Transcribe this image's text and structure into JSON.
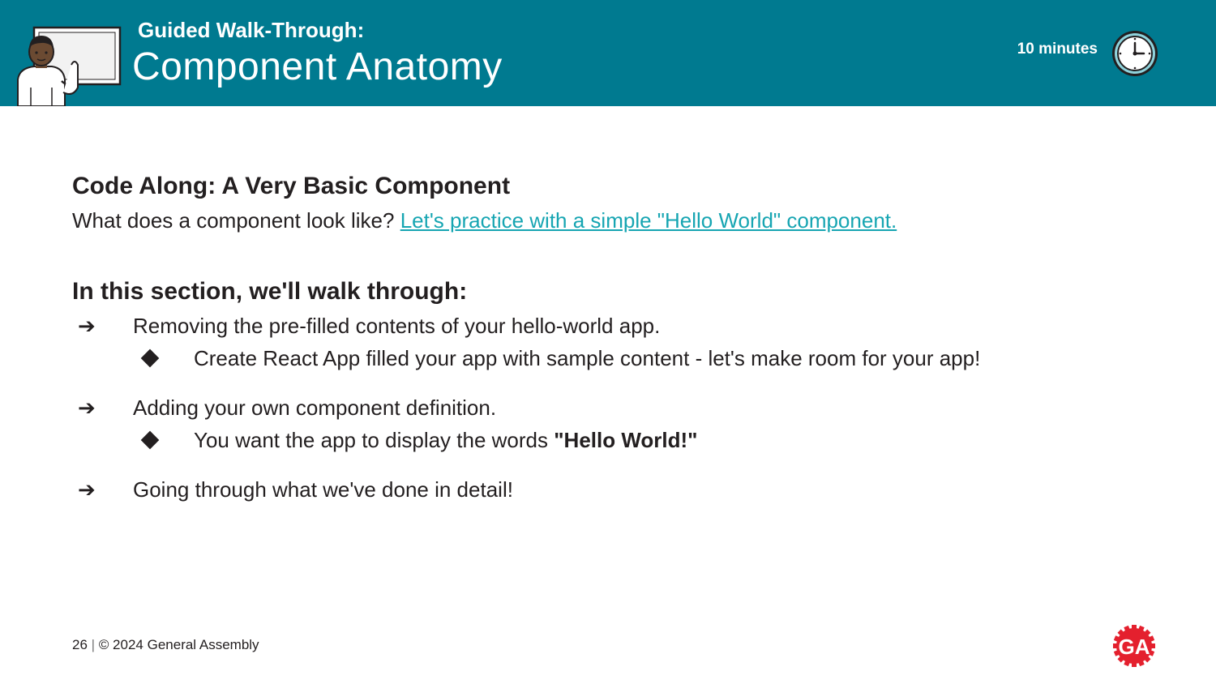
{
  "header": {
    "kicker": "Guided Walk-Through:",
    "title": "Component Anatomy",
    "duration": "10 minutes",
    "background_color": "#007a90"
  },
  "section1": {
    "heading": "Code Along: A Very Basic Component",
    "text": "What does a component look like?",
    "link_text": "Let's practice with a simple \"Hello World\" component."
  },
  "section2": {
    "heading": "In this section, we'll walk through:",
    "bullets": [
      {
        "text": "Removing the pre-filled contents of your hello-world app.",
        "sub": "Create React App filled your app with sample content - let's make room for your app!"
      },
      {
        "text": "Adding your own component definition.",
        "sub_prefix": "You want the app to display the words",
        "sub_bold": "\"Hello World!\""
      },
      {
        "text": "Going through what we've done in detail!"
      }
    ]
  },
  "footer": {
    "page": "26",
    "separator": "|",
    "copyright": "© 2024 General Assembly"
  },
  "logo_text": "GA",
  "colors": {
    "link": "#16a5b2",
    "logo": "#e4202e"
  }
}
